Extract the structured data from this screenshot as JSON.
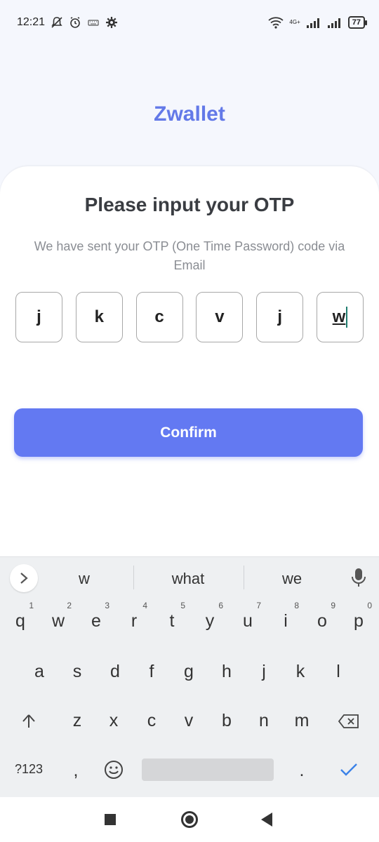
{
  "status_bar": {
    "time": "12:21",
    "network_label": "4G+",
    "battery": "77"
  },
  "app": {
    "brand": "Zwallet"
  },
  "card": {
    "title": "Please input your OTP",
    "description": "We have sent your OTP (One Time Password) code via Email",
    "otp": [
      "j",
      "k",
      "c",
      "v",
      "j",
      "w"
    ],
    "confirm_label": "Confirm"
  },
  "keyboard": {
    "suggestions": [
      "w",
      "what",
      "we"
    ],
    "row1": [
      {
        "key": "q",
        "hint": "1"
      },
      {
        "key": "w",
        "hint": "2"
      },
      {
        "key": "e",
        "hint": "3"
      },
      {
        "key": "r",
        "hint": "4"
      },
      {
        "key": "t",
        "hint": "5"
      },
      {
        "key": "y",
        "hint": "6"
      },
      {
        "key": "u",
        "hint": "7"
      },
      {
        "key": "i",
        "hint": "8"
      },
      {
        "key": "o",
        "hint": "9"
      },
      {
        "key": "p",
        "hint": "0"
      }
    ],
    "row2": [
      "a",
      "s",
      "d",
      "f",
      "g",
      "h",
      "j",
      "k",
      "l"
    ],
    "row3": [
      "z",
      "x",
      "c",
      "v",
      "b",
      "n",
      "m"
    ],
    "symbols_label": "?123",
    "comma": ",",
    "period": "."
  },
  "colors": {
    "accent": "#6379f2",
    "brand": "#6379e8",
    "cursor": "#1e7d6f",
    "check": "#3b82e8"
  }
}
